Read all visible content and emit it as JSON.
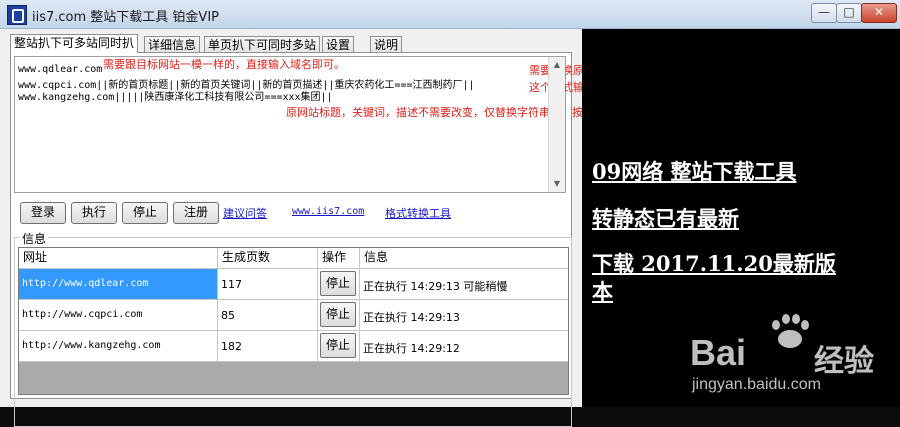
{
  "window": {
    "title": "iis7.com 整站下载工具 铂金VIP",
    "minimize": "—",
    "maximize": "□",
    "close": "✕"
  },
  "tabs": [
    "整站扒下可多站同时扒",
    "详细信息",
    "单页扒下可同时多站",
    "设置",
    "说明"
  ],
  "input": {
    "lines": [
      "www.qdlear.com",
      "www.cqpci.com||新的首页标题||新的首页关键词||新的首页描述||重庆农药化工===江西制药厂||",
      "www.kangzehg.com|||||陕西康泽化工科技有限公司===xxx集团||"
    ],
    "notes": [
      "需要跟目标网站一模一样的，直接输入域名即可。",
      "需要替换原网站的首页标题，关键词，描述的，字符串的，按照",
      "这个格式输入",
      "原网站标题，关键词，描述不需要改变，仅替换字符串的，按照这个格式输入。"
    ]
  },
  "buttons": {
    "login": "登录",
    "run": "执行",
    "stop": "停止",
    "register": "注册"
  },
  "links": {
    "faq": "建议问答",
    "site": "www.iis7.com",
    "convert": "格式转换工具"
  },
  "info": {
    "group_label": "信息",
    "columns": [
      "网址",
      "生成页数",
      "操作",
      "信息"
    ],
    "rows": [
      {
        "url": "http://www.qdlear.com",
        "pages": "117",
        "action": "停止",
        "info": "正在执行 14:29:13 可能稍慢"
      },
      {
        "url": "http://www.cqpci.com",
        "pages": "85",
        "action": "停止",
        "info": "正在执行 14:29:13"
      },
      {
        "url": "http://www.kangzehg.com",
        "pages": "182",
        "action": "停止",
        "info": "正在执行 14:29:12"
      }
    ]
  },
  "side": {
    "line1": "09网络 整站下载工具",
    "line2": "转静态已有最新",
    "line3a": "下载 2017.11.20最新版",
    "line3b": "本"
  },
  "watermark": {
    "brand": "Bai",
    "brand2": "经验",
    "url": "jingyan.baidu.com"
  }
}
